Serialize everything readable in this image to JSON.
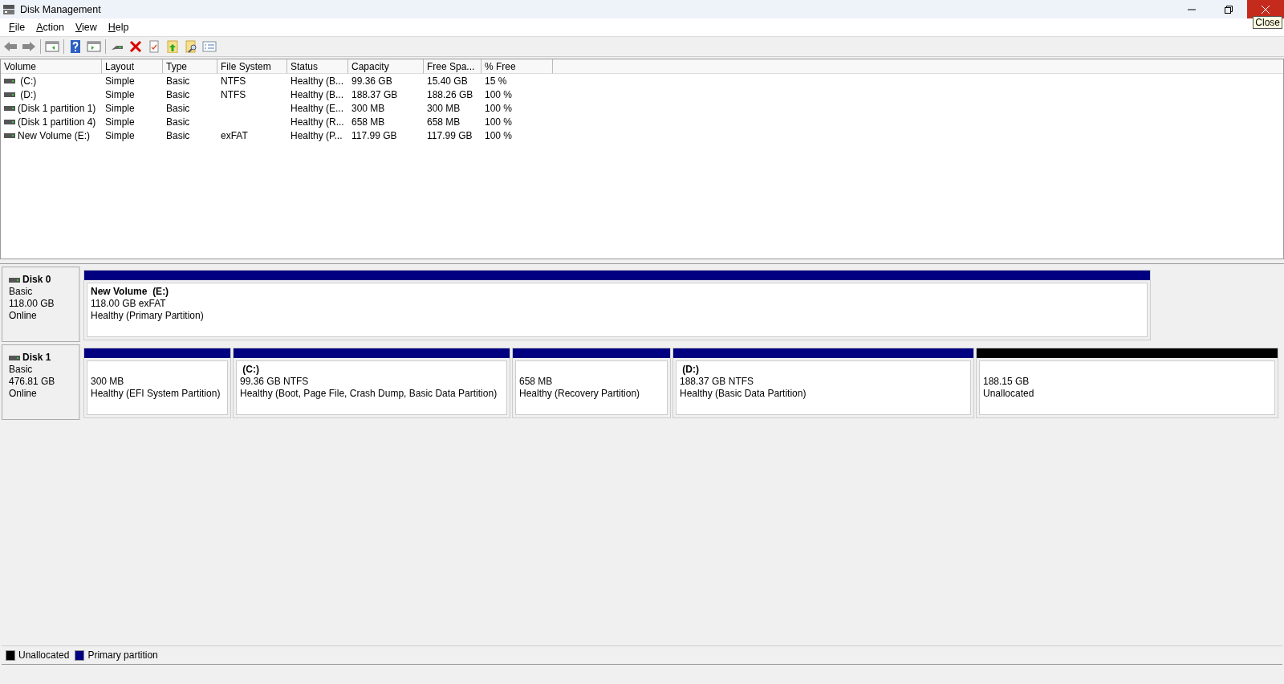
{
  "window": {
    "title": "Disk Management"
  },
  "menu": [
    "File",
    "Action",
    "View",
    "Help"
  ],
  "tooltip": "Close",
  "table": {
    "columns": [
      "Volume",
      "Layout",
      "Type",
      "File System",
      "Status",
      "Capacity",
      "Free Spa...",
      "% Free"
    ],
    "rows": [
      {
        "cells": [
          " (C:)",
          "Simple",
          "Basic",
          "NTFS",
          "Healthy (B...",
          "99.36 GB",
          "15.40 GB",
          "15 %"
        ]
      },
      {
        "cells": [
          " (D:)",
          "Simple",
          "Basic",
          "NTFS",
          "Healthy (B...",
          "188.37 GB",
          "188.26 GB",
          "100 %"
        ]
      },
      {
        "cells": [
          "(Disk 1 partition 1)",
          "Simple",
          "Basic",
          "",
          "Healthy (E...",
          "300 MB",
          "300 MB",
          "100 %"
        ]
      },
      {
        "cells": [
          "(Disk 1 partition 4)",
          "Simple",
          "Basic",
          "",
          "Healthy (R...",
          "658 MB",
          "658 MB",
          "100 %"
        ]
      },
      {
        "cells": [
          "New Volume (E:)",
          "Simple",
          "Basic",
          "exFAT",
          "Healthy (P...",
          "117.99 GB",
          "117.99 GB",
          "100 %"
        ]
      }
    ]
  },
  "disks": [
    {
      "name": "Disk 0",
      "type": "Basic",
      "size": "118.00 GB",
      "status": "Online",
      "partitions": [
        {
          "kind": "primary",
          "title": "New Volume  (E:)",
          "size": "118.00 GB exFAT",
          "status": "Healthy (Primary Partition)"
        }
      ]
    },
    {
      "name": "Disk 1",
      "type": "Basic",
      "size": "476.81 GB",
      "status": "Online",
      "partitions": [
        {
          "kind": "primary",
          "size": "300 MB",
          "status": "Healthy (EFI System Partition)"
        },
        {
          "kind": "primary",
          "title": " (C:)",
          "size": "99.36 GB NTFS",
          "status": "Healthy (Boot, Page File, Crash Dump, Basic Data Partition)"
        },
        {
          "kind": "primary",
          "size": "658 MB",
          "status": "Healthy (Recovery Partition)"
        },
        {
          "kind": "primary",
          "title": " (D:)",
          "size": "188.37 GB NTFS",
          "status": "Healthy (Basic Data Partition)"
        },
        {
          "kind": "unallocated",
          "size": "188.15 GB",
          "status": "Unallocated"
        }
      ]
    }
  ],
  "legend": [
    {
      "label": "Unallocated",
      "color": "#000000"
    },
    {
      "label": "Primary partition",
      "color": "#000080"
    }
  ]
}
